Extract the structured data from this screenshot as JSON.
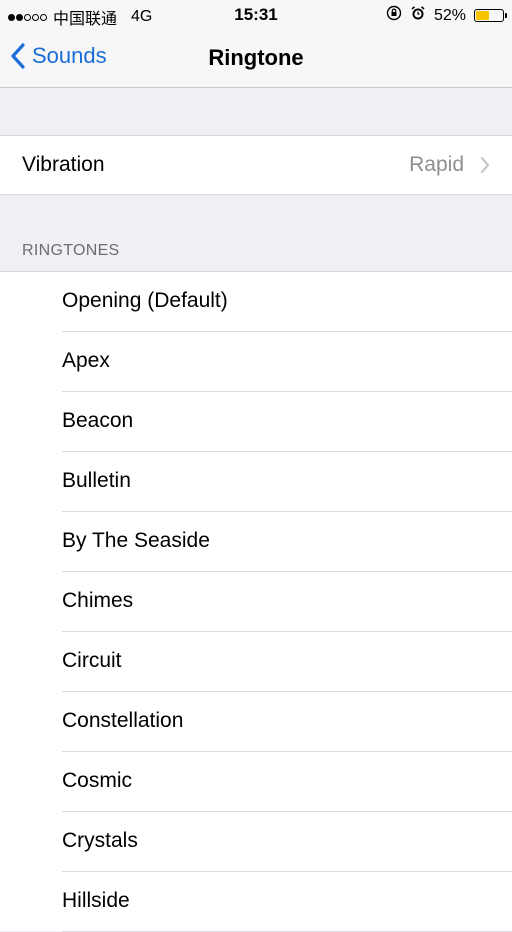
{
  "status_bar": {
    "carrier": "中国联通",
    "network": "4G",
    "time": "15:31",
    "battery_text": "52%",
    "battery_level": 0.52,
    "battery_color": "#f7c300"
  },
  "nav": {
    "back_label": "Sounds",
    "title": "Ringtone"
  },
  "vibration": {
    "label": "Vibration",
    "value": "Rapid"
  },
  "ringtones": {
    "header": "RINGTONES",
    "items": [
      "Opening (Default)",
      "Apex",
      "Beacon",
      "Bulletin",
      "By The Seaside",
      "Chimes",
      "Circuit",
      "Constellation",
      "Cosmic",
      "Crystals",
      "Hillside"
    ]
  },
  "colors": {
    "accent": "#1a6ed8",
    "secondary_text": "#8e8e93",
    "background": "#efeff4"
  }
}
